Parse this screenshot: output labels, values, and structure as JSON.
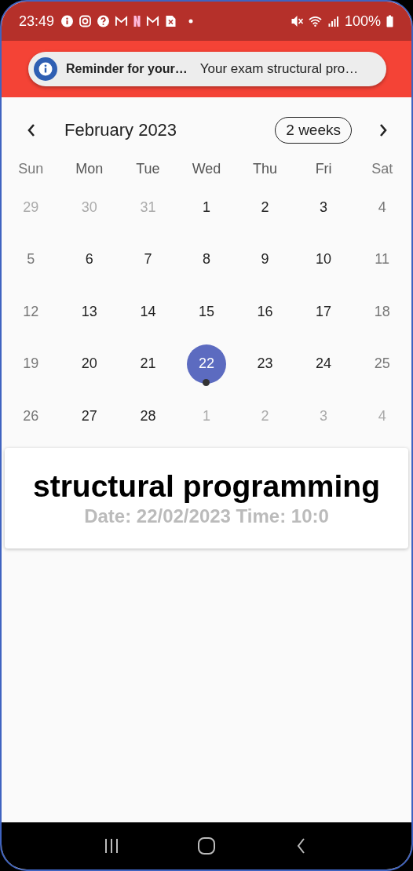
{
  "status_bar": {
    "time": "23:49",
    "battery": "100%"
  },
  "notification": {
    "title": "Reminder for your…",
    "text": "Your exam structural pro…"
  },
  "calendar": {
    "month": "February 2023",
    "format_button": "2 weeks",
    "weekdays": [
      {
        "label": "Sun",
        "kind": "weekend"
      },
      {
        "label": "Mon",
        "kind": "weekday"
      },
      {
        "label": "Tue",
        "kind": "weekday"
      },
      {
        "label": "Wed",
        "kind": "weekday"
      },
      {
        "label": "Thu",
        "kind": "weekday"
      },
      {
        "label": "Fri",
        "kind": "weekday"
      },
      {
        "label": "Sat",
        "kind": "weekend"
      }
    ],
    "weeks": [
      [
        {
          "day": "29",
          "kind": "other_month",
          "selected": false,
          "has_event": false
        },
        {
          "day": "30",
          "kind": "other_month",
          "selected": false,
          "has_event": false
        },
        {
          "day": "31",
          "kind": "other_month",
          "selected": false,
          "has_event": false
        },
        {
          "day": "1",
          "kind": "weekday",
          "selected": false,
          "has_event": false
        },
        {
          "day": "2",
          "kind": "weekday",
          "selected": false,
          "has_event": false
        },
        {
          "day": "3",
          "kind": "weekday",
          "selected": false,
          "has_event": false
        },
        {
          "day": "4",
          "kind": "weekend",
          "selected": false,
          "has_event": false
        }
      ],
      [
        {
          "day": "5",
          "kind": "weekend",
          "selected": false,
          "has_event": false
        },
        {
          "day": "6",
          "kind": "weekday",
          "selected": false,
          "has_event": false
        },
        {
          "day": "7",
          "kind": "weekday",
          "selected": false,
          "has_event": false
        },
        {
          "day": "8",
          "kind": "weekday",
          "selected": false,
          "has_event": false
        },
        {
          "day": "9",
          "kind": "weekday",
          "selected": false,
          "has_event": false
        },
        {
          "day": "10",
          "kind": "weekday",
          "selected": false,
          "has_event": false
        },
        {
          "day": "11",
          "kind": "weekend",
          "selected": false,
          "has_event": false
        }
      ],
      [
        {
          "day": "12",
          "kind": "weekend",
          "selected": false,
          "has_event": false
        },
        {
          "day": "13",
          "kind": "weekday",
          "selected": false,
          "has_event": false
        },
        {
          "day": "14",
          "kind": "weekday",
          "selected": false,
          "has_event": false
        },
        {
          "day": "15",
          "kind": "weekday",
          "selected": false,
          "has_event": false
        },
        {
          "day": "16",
          "kind": "weekday",
          "selected": false,
          "has_event": false
        },
        {
          "day": "17",
          "kind": "weekday",
          "selected": false,
          "has_event": false
        },
        {
          "day": "18",
          "kind": "weekend",
          "selected": false,
          "has_event": false
        }
      ],
      [
        {
          "day": "19",
          "kind": "weekend",
          "selected": false,
          "has_event": false
        },
        {
          "day": "20",
          "kind": "weekday",
          "selected": false,
          "has_event": false
        },
        {
          "day": "21",
          "kind": "weekday",
          "selected": false,
          "has_event": false
        },
        {
          "day": "22",
          "kind": "weekday",
          "selected": true,
          "has_event": true
        },
        {
          "day": "23",
          "kind": "weekday",
          "selected": false,
          "has_event": false
        },
        {
          "day": "24",
          "kind": "weekday",
          "selected": false,
          "has_event": false
        },
        {
          "day": "25",
          "kind": "weekend",
          "selected": false,
          "has_event": false
        }
      ],
      [
        {
          "day": "26",
          "kind": "weekend",
          "selected": false,
          "has_event": false
        },
        {
          "day": "27",
          "kind": "weekday",
          "selected": false,
          "has_event": false
        },
        {
          "day": "28",
          "kind": "weekday",
          "selected": false,
          "has_event": false
        },
        {
          "day": "1",
          "kind": "other_month",
          "selected": false,
          "has_event": false
        },
        {
          "day": "2",
          "kind": "other_month",
          "selected": false,
          "has_event": false
        },
        {
          "day": "3",
          "kind": "other_month",
          "selected": false,
          "has_event": false
        },
        {
          "day": "4",
          "kind": "other_month",
          "selected": false,
          "has_event": false
        }
      ]
    ]
  },
  "event": {
    "title": "structural programming",
    "details": "Date: 22/02/2023 Time: 10:0"
  }
}
